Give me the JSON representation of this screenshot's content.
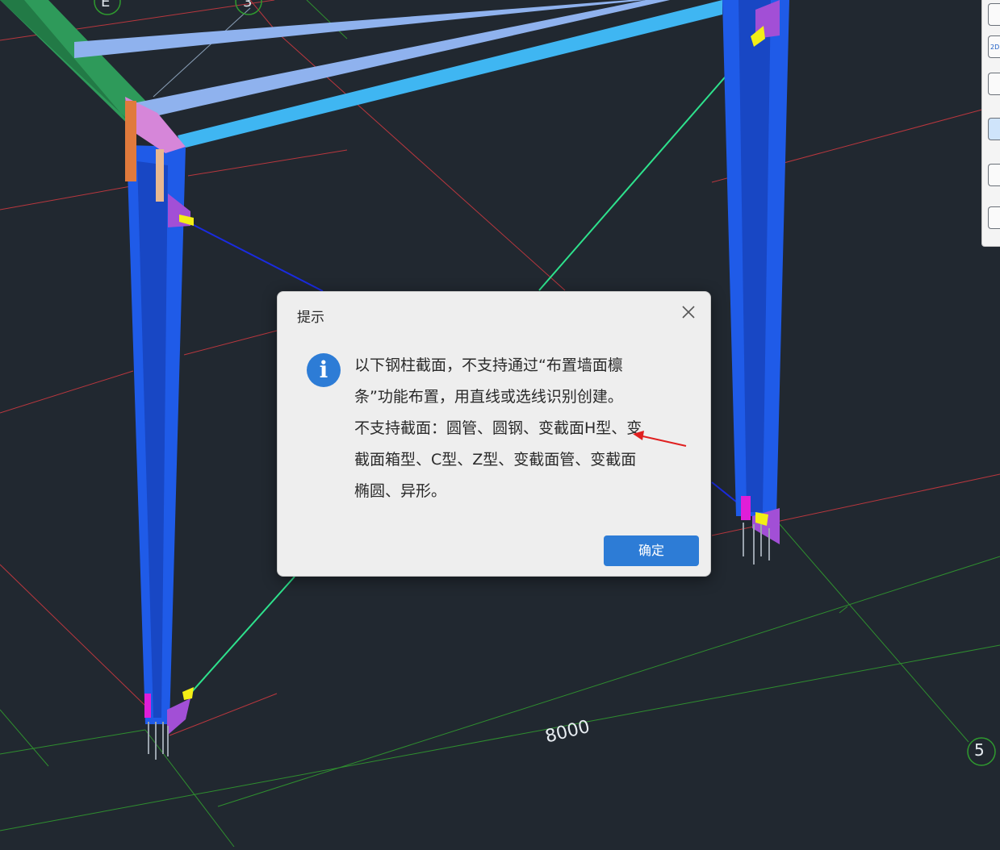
{
  "scene": {
    "dimension_label": "8000",
    "axis_labels": [
      "E",
      "3",
      "5"
    ]
  },
  "toolbar": {
    "tools": [
      {
        "icon": "cloud-icon"
      },
      {
        "icon": "2d-view-icon",
        "text": "2D"
      },
      {
        "icon": "cube-top-icon"
      },
      {
        "icon": "cube-front-icon"
      },
      {
        "icon": "bracket-icon"
      },
      {
        "icon": "list-icon"
      }
    ]
  },
  "dialog": {
    "title": "提示",
    "message_lines": [
      "以下钢柱截面，不支持通过“布置墙面檩",
      "条”功能布置，用直线或选线识别创建。",
      "不支持截面：圆管、圆钢、变截面H型、变",
      "截面箱型、C型、Z型、变截面管、变截面",
      "椭圆、异形。"
    ],
    "confirm_label": "确定",
    "icon": "info-icon",
    "colors": {
      "accent": "#2d7cd6",
      "background": "#eeeeee"
    }
  },
  "colors": {
    "canvas": "#212830",
    "column_blue": "#1f5be8",
    "purlin_light": "#8fb2ee",
    "purlin_cyan": "#3fb6f2",
    "beam_green": "#2e9a5a",
    "brace_green": "#2ee28d",
    "grid_red": "#b9373e",
    "grid_green": "#2f8f2f",
    "plate_purple": "#a24fd6",
    "annotation_red": "#e02020"
  }
}
